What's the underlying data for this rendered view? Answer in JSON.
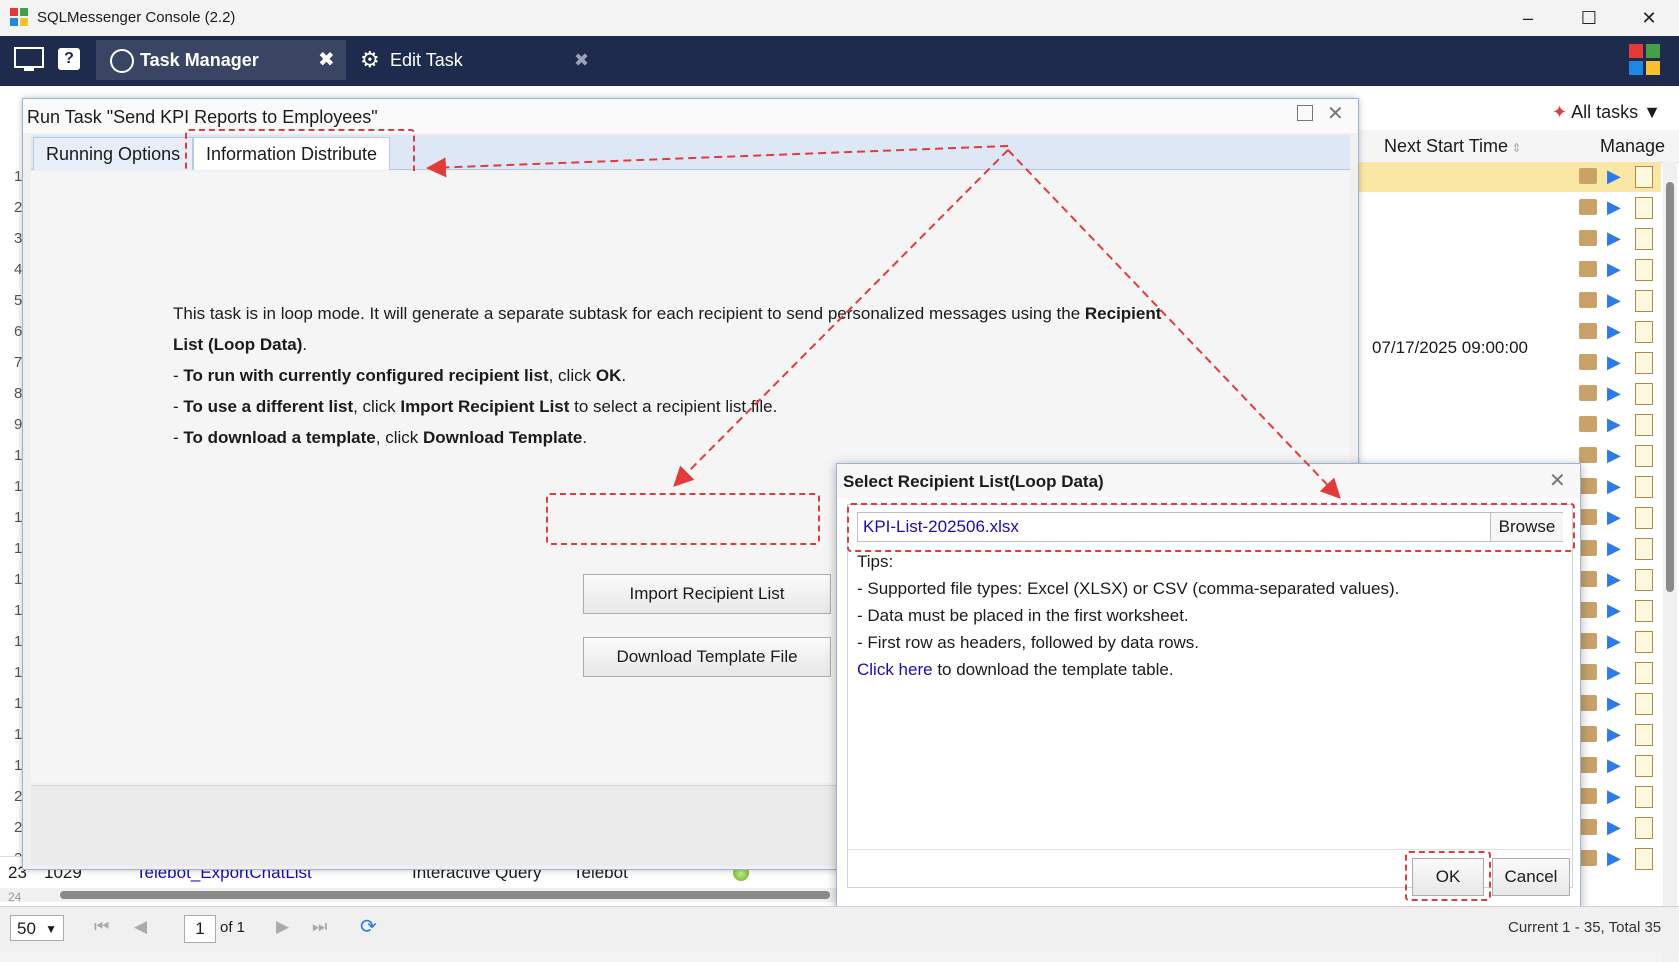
{
  "window": {
    "title": "SQLMessenger Console (2.2)",
    "minimize": "–",
    "maximize": "☐",
    "close": "✕"
  },
  "toolbar": {
    "tab_task_manager": "Task Manager",
    "tab_edit_task": "Edit Task",
    "help": "?"
  },
  "grid": {
    "all_tasks": "All tasks",
    "col_next_start": "Next Start Time",
    "col_manage": "Manage",
    "row7_next_start": "07/17/2025 09:00:00",
    "row_numbers": [
      "1",
      "2",
      "3",
      "4",
      "5",
      "6",
      "7",
      "8",
      "9",
      "1",
      "1",
      "1",
      "1",
      "1",
      "1",
      "1",
      "1",
      "1",
      "1",
      "1",
      "2",
      "2",
      "2"
    ],
    "last_row": {
      "num": "23",
      "id": "1029",
      "name": "Telebot_ExportChatList",
      "type": "Interactive Query",
      "category": "Telebot"
    },
    "next_row_num": "24"
  },
  "run_dialog": {
    "title": "Run Task \"Send KPI Reports to Employees\"",
    "tab_running_options": "Running Options",
    "tab_information_distribute": "Information Distribute",
    "msg_line1_a": "This task is in loop mode. It will generate a separate subtask for each recipient to send personalized messages using the ",
    "msg_line1_b": "Recipient",
    "msg_line2_b": "List (Loop Data)",
    "msg_line2_end": ".",
    "b1_dash": "- ",
    "b1_bold": "To run with currently configured recipient list",
    "b1_mid": ", click ",
    "b1_ok": "OK",
    "b1_end": ".",
    "b2_dash": "- ",
    "b2_bold": "To use a different list",
    "b2_mid": ", click ",
    "b2_bold2": "Import Recipient List",
    "b2_end": " to select a recipient list file.",
    "b3_dash": "- ",
    "b3_bold": "To download a template",
    "b3_mid": ", click ",
    "b3_bold2": "Download Template",
    "b3_end": ".",
    "import_button": "Import Recipient List",
    "download_button": "Download Template File"
  },
  "recipient_dialog": {
    "title": "Select Recipient List(Loop Data)",
    "file_value": "KPI-List-202506.xlsx",
    "browse": "Browse",
    "tips_title": "Tips:",
    "tip1": "- Supported file types: Excel (XLSX) or CSV (comma-separated values).",
    "tip2": "- Data must be placed in the first worksheet.",
    "tip3": "- First row as headers, followed by data rows.",
    "click_here": "Click here",
    "click_here_rest": " to download the template table.",
    "ok": "OK",
    "cancel": "Cancel"
  },
  "pager": {
    "page_size": "50",
    "page": "1",
    "of": "of 1",
    "summary": "Current 1 - 35, Total 35"
  }
}
